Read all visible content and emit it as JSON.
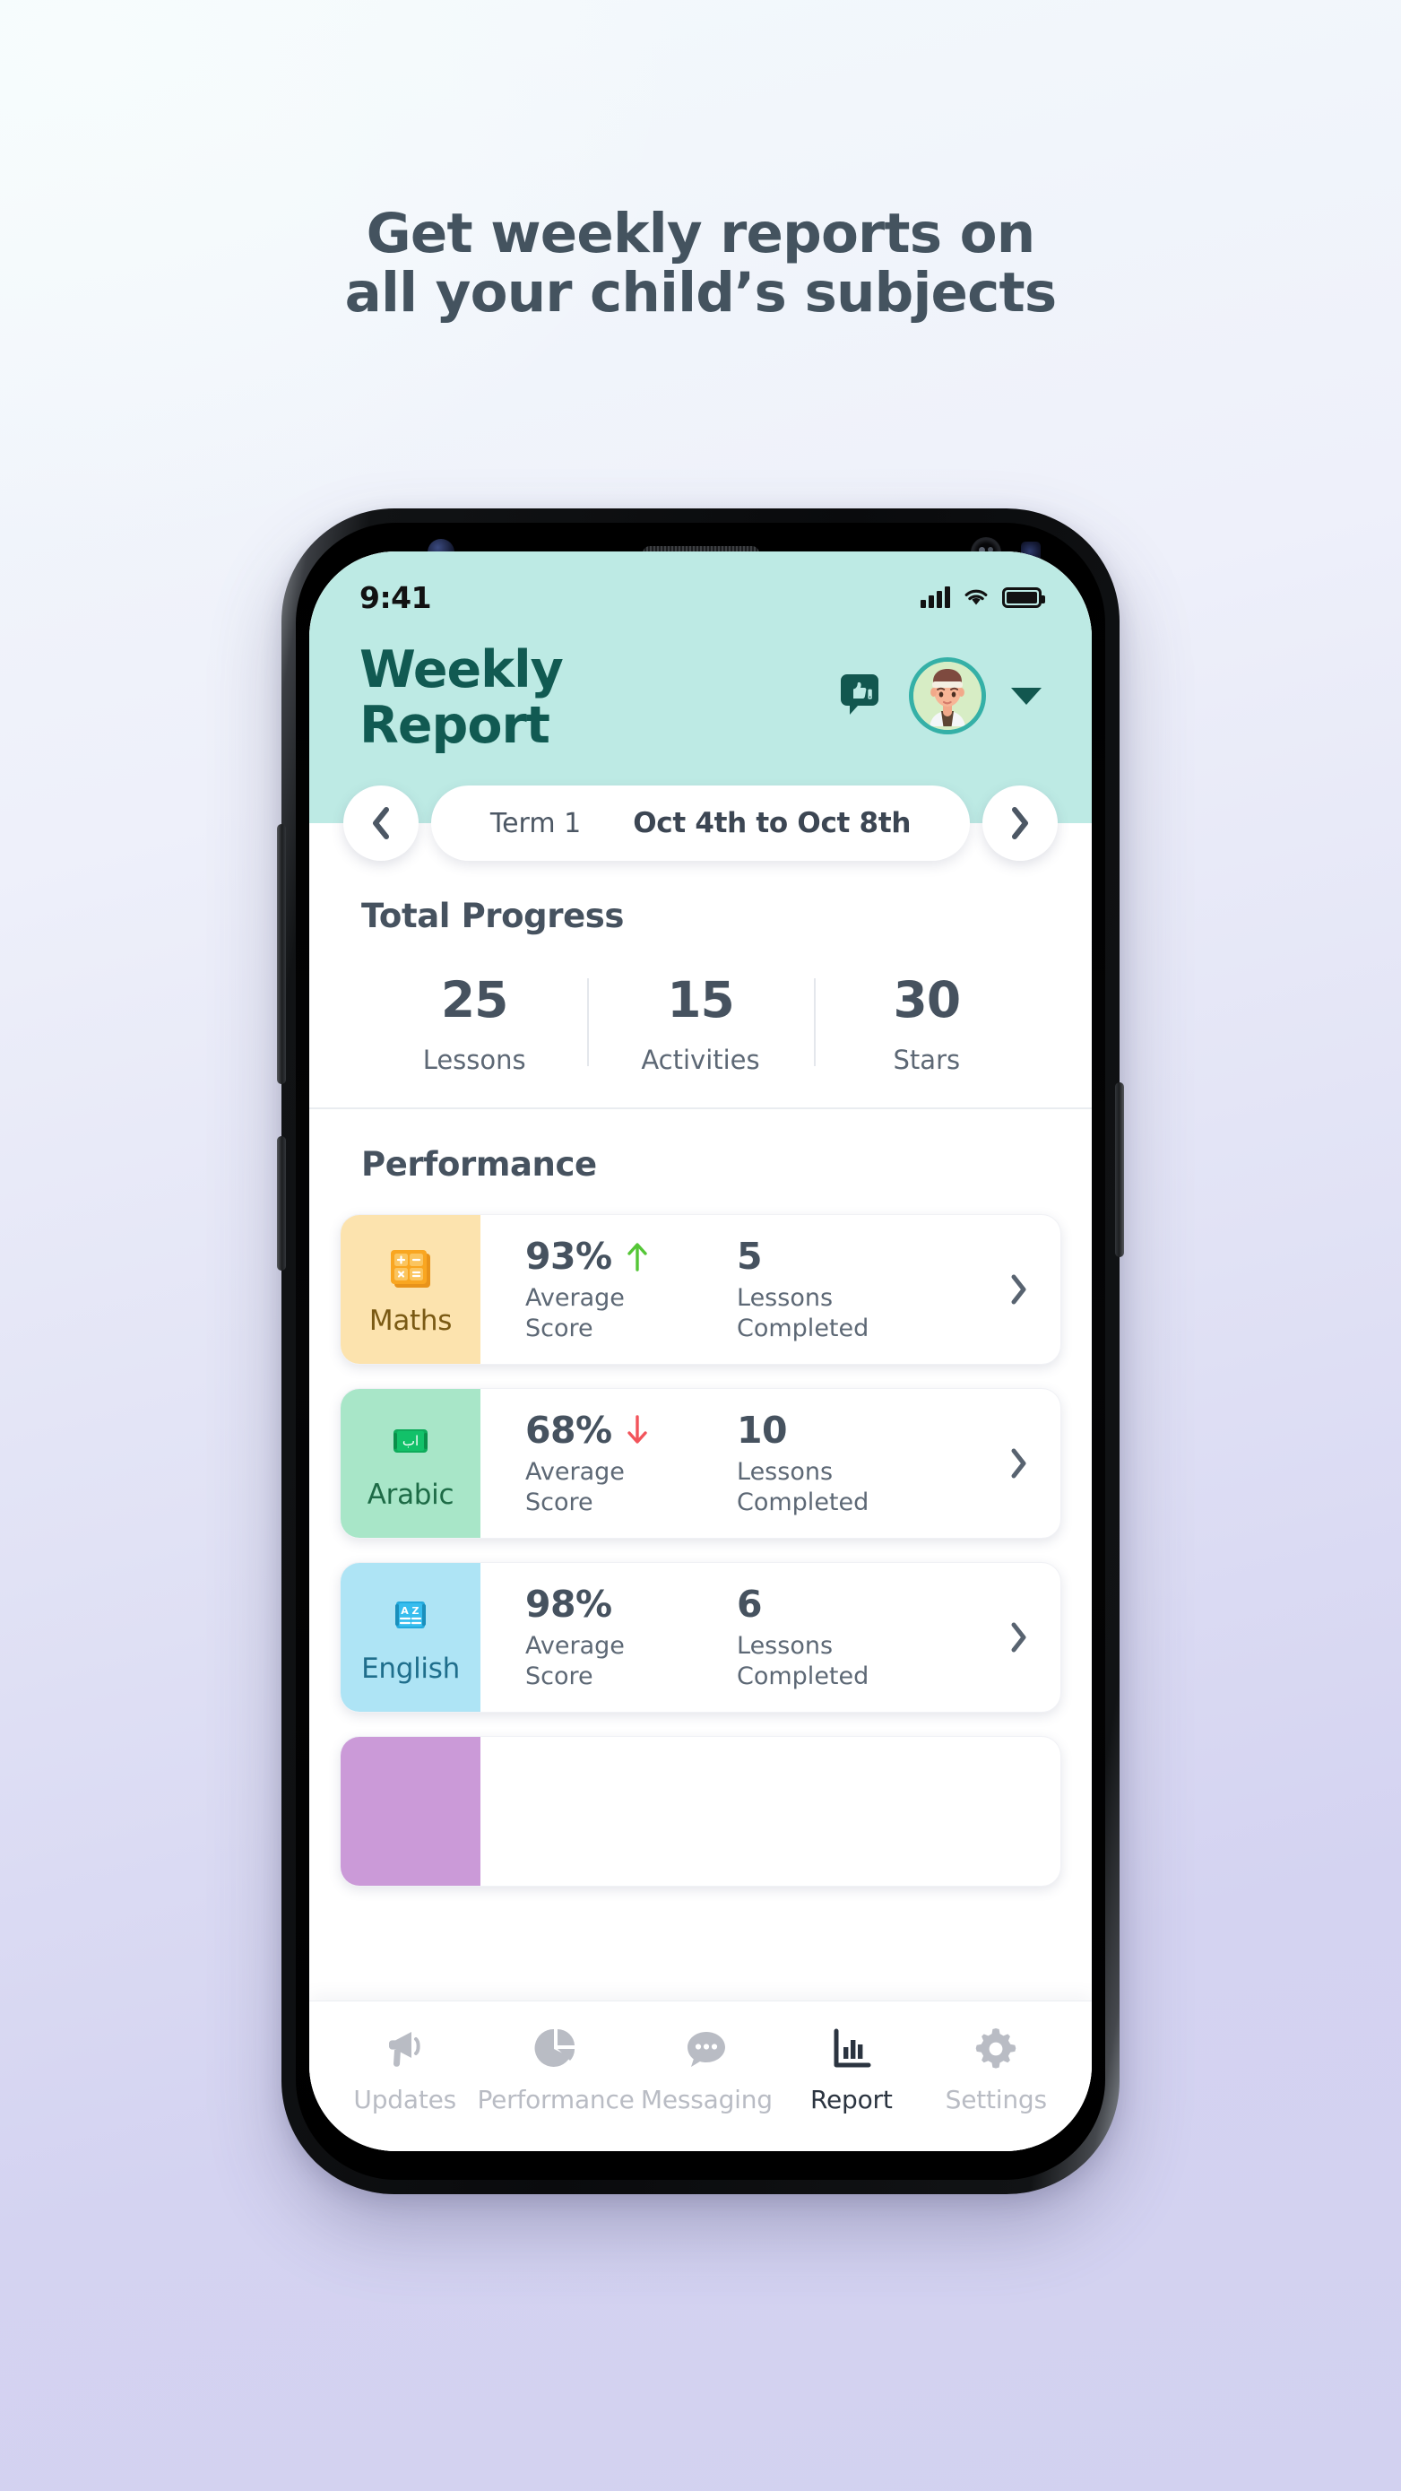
{
  "headline": {
    "line1": "Get weekly reports on",
    "line2": "all your child’s subjects",
    "color": "#44535f"
  },
  "statusbar": {
    "time": "9:41",
    "signal_icon": "cellular-signal-icon",
    "wifi_icon": "wifi-icon",
    "battery_icon": "battery-full-icon"
  },
  "header": {
    "title_line1": "Weekly",
    "title_line2": "Report",
    "title_color": "#115a52",
    "background": "#bdeae4",
    "feedback_icon": "thumbs-up-chat-icon",
    "avatar_icon": "child-avatar",
    "dropdown_icon": "chevron-down-icon"
  },
  "date_selector": {
    "prev_icon": "chevron-left-icon",
    "next_icon": "chevron-right-icon",
    "term": "Term 1",
    "range": "Oct 4th to Oct 8th"
  },
  "total_progress": {
    "title": "Total Progress",
    "stats": [
      {
        "value": "25",
        "label": "Lessons"
      },
      {
        "value": "15",
        "label": "Activities"
      },
      {
        "value": "30",
        "label": "Stars"
      }
    ]
  },
  "performance": {
    "title": "Performance",
    "metric_label_score": "Average\nScore",
    "metric_label_lessons": "Lessons\nCompleted",
    "chevron_icon": "chevron-right-icon",
    "trend_up_color": "#55c637",
    "trend_down_color": "#f2545b",
    "cards": [
      {
        "subject": "Maths",
        "panel_color": "#fce3ae",
        "icon": "calculator-icon",
        "icon_color": "#f9a621",
        "label_color": "#7a5a14",
        "score": "93%",
        "trend": "up",
        "score_label": "Average Score",
        "lessons": "5",
        "lessons_label": "Lessons Completed"
      },
      {
        "subject": "Arabic",
        "panel_color": "#a8e6c8",
        "icon": "arabic-book-icon",
        "icon_color": "#0fab5b",
        "label_color": "#1d6b46",
        "score": "68%",
        "trend": "down",
        "score_label": "Average Score",
        "lessons": "10",
        "lessons_label": "Lessons Completed"
      },
      {
        "subject": "English",
        "panel_color": "#aee4f5",
        "icon": "az-dictionary-icon",
        "icon_color": "#23aadd",
        "label_color": "#1f6e8c",
        "score": "98%",
        "trend": "none",
        "score_label": "Average Score",
        "lessons": "6",
        "lessons_label": "Lessons Completed"
      },
      {
        "subject": "",
        "panel_color": "#cb9ad8",
        "icon": "subject-icon",
        "icon_color": "#9b4fc0",
        "label_color": "#6c2f87",
        "score": "",
        "trend": "none",
        "score_label": "",
        "lessons": "",
        "lessons_label": ""
      }
    ]
  },
  "bottom_nav": {
    "items": [
      {
        "label": "Updates",
        "icon": "megaphone-icon",
        "active": false
      },
      {
        "label": "Performance",
        "icon": "pie-chart-icon",
        "active": false
      },
      {
        "label": "Messaging",
        "icon": "speech-bubble-icon",
        "active": false
      },
      {
        "label": "Report",
        "icon": "bar-chart-icon",
        "active": true
      },
      {
        "label": "Settings",
        "icon": "gear-icon",
        "active": false
      }
    ],
    "inactive_color": "#b9bcc4",
    "active_color": "#2b3440"
  }
}
